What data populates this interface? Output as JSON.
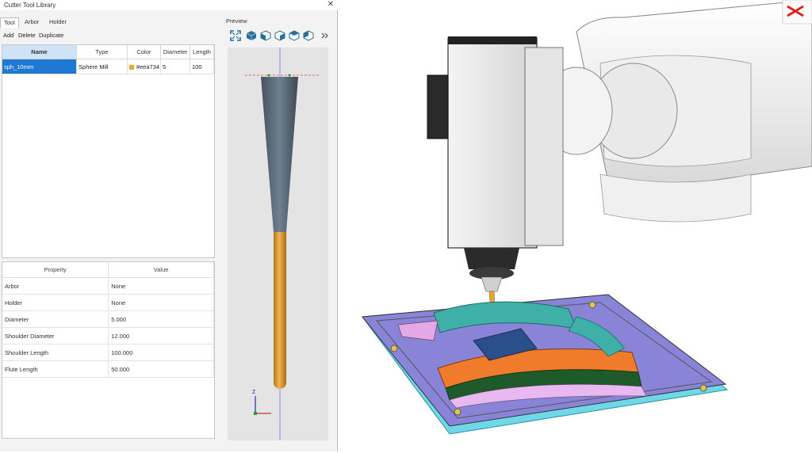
{
  "window": {
    "title": "Cutter Tool Library",
    "close": "✕"
  },
  "tabs": [
    {
      "label": "Tool"
    },
    {
      "label": "Arbor"
    },
    {
      "label": "Holder"
    }
  ],
  "toolbar": {
    "add": "Add",
    "delete": "Delete",
    "duplicate": "Duplicate"
  },
  "tool_table": {
    "headers": [
      "Name",
      "Type",
      "Color",
      "Diameter",
      "Length"
    ],
    "rows": [
      {
        "name": "sph_10mm",
        "type": "Sphere Mill",
        "color_label": "#eea734",
        "color": "#eea734",
        "diameter": "5",
        "length": "100"
      }
    ]
  },
  "properties": {
    "headers": [
      "Property",
      "Value"
    ],
    "rows": [
      {
        "property": "Arbor",
        "value": "None"
      },
      {
        "property": "Holder",
        "value": "None"
      },
      {
        "property": "Diameter",
        "value": "5.000"
      },
      {
        "property": "Shoulder Diameter",
        "value": "12.000"
      },
      {
        "property": "Shoulder Length",
        "value": "100.000"
      },
      {
        "property": "Flute Length",
        "value": "50.000"
      }
    ]
  },
  "preview": {
    "label": "Preview",
    "view_icons": [
      "fit-all-icon",
      "iso-view-icon",
      "front-view-icon",
      "right-view-icon",
      "top-view-icon",
      "left-view-icon",
      "more-icon"
    ],
    "axis_z": "Z"
  },
  "colors": {
    "selection": "#1f78d1",
    "header_highlight": "#cfe3f7",
    "shoulder": "#5b6b7b",
    "flute": "#e8a437",
    "fixture_plate": "#8a84d8",
    "base": "#6fd8e8"
  }
}
